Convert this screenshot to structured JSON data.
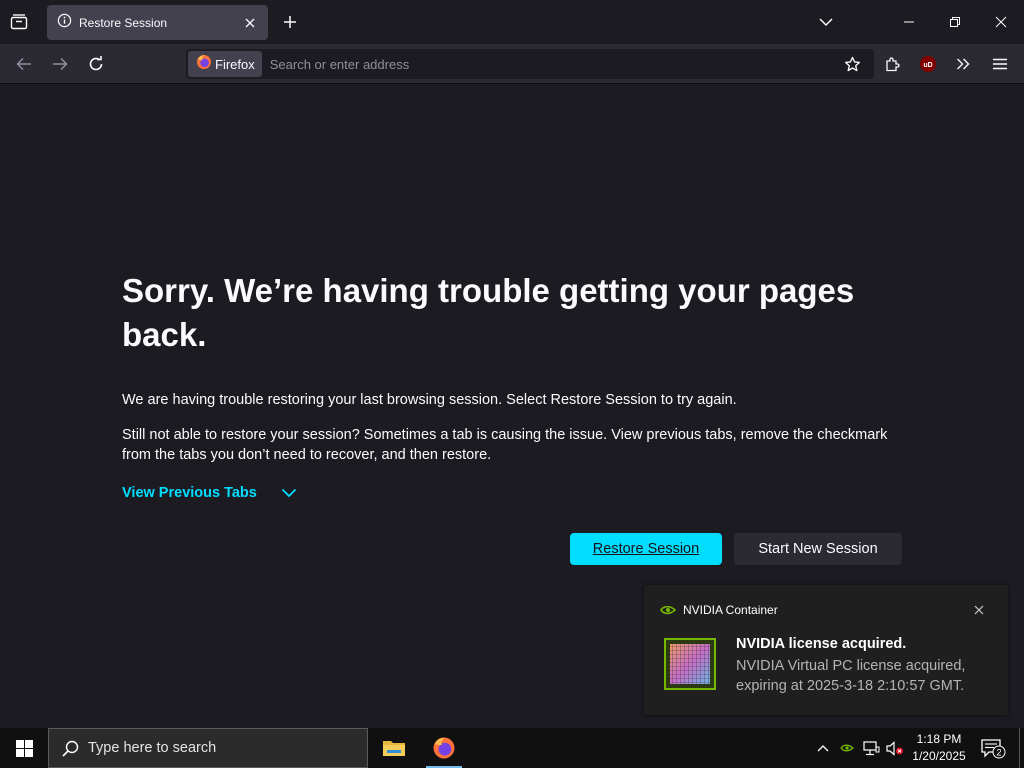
{
  "browser": {
    "tab": {
      "title": "Restore Session"
    },
    "identity_label": "Firefox",
    "url_placeholder": "Search or enter address",
    "extension_badge": "uD"
  },
  "page": {
    "heading": "Sorry. We’re having trouble getting your pages back.",
    "paragraph1": "We are having trouble restoring your last browsing session. Select Restore Session to try again.",
    "paragraph2": "Still not able to restore your session? Sometimes a tab is causing the issue. View previous tabs, remove the checkmark from the tabs you don’t need to recover, and then restore.",
    "view_previous_tabs": "View Previous Tabs",
    "restore_button": "Restore Session",
    "new_session_button": "Start New Session"
  },
  "notification": {
    "app_name": "NVIDIA Container",
    "title": "NVIDIA license acquired.",
    "body": "NVIDIA Virtual PC license acquired, expiring at 2025-3-18 2:10:57 GMT."
  },
  "taskbar": {
    "search_placeholder": "Type here to search",
    "time": "1:18 PM",
    "date": "1/20/2025",
    "notification_count": "2"
  },
  "colors": {
    "accent": "#00ddff",
    "page_bg": "#1c1b22",
    "toolbar_bg": "#2b2a33",
    "nvidia_green": "#76b900"
  }
}
